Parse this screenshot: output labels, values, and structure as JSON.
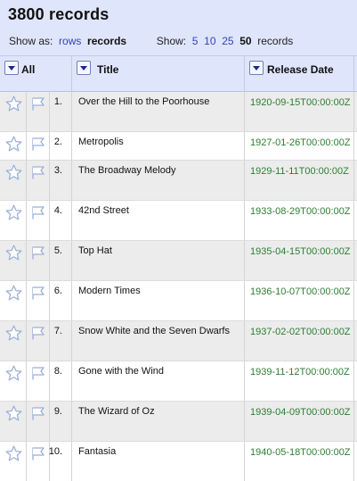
{
  "header": {
    "record_count": "3800 records",
    "show_as_label": "Show as:",
    "view_rows": "rows",
    "view_records": "records",
    "show_label": "Show:",
    "page_sizes": [
      "5",
      "10",
      "25"
    ],
    "page_size_selected": "50",
    "page_size_suffix": "records"
  },
  "columns": {
    "all": "All",
    "title": "Title",
    "release_date": "Release Date"
  },
  "rows": [
    {
      "num": "1.",
      "title": "Over the Hill to the Poorhouse",
      "date": "1920-09-15T00:00:00Z"
    },
    {
      "num": "2.",
      "title": "Metropolis",
      "date": "1927-01-26T00:00:00Z"
    },
    {
      "num": "3.",
      "title": "The Broadway Melody",
      "date": "1929-11-11T00:00:00Z"
    },
    {
      "num": "4.",
      "title": "42nd Street",
      "date": "1933-08-29T00:00:00Z"
    },
    {
      "num": "5.",
      "title": "Top Hat",
      "date": "1935-04-15T00:00:00Z"
    },
    {
      "num": "6.",
      "title": "Modern Times",
      "date": "1936-10-07T00:00:00Z"
    },
    {
      "num": "7.",
      "title": "Snow White and the Seven Dwarfs",
      "date": "1937-02-02T00:00:00Z"
    },
    {
      "num": "8.",
      "title": "Gone with the Wind",
      "date": "1939-11-12T00:00:00Z"
    },
    {
      "num": "9.",
      "title": "The Wizard of Oz",
      "date": "1939-04-09T00:00:00Z"
    },
    {
      "num": "10.",
      "title": "Fantasia",
      "date": "1940-05-18T00:00:00Z"
    }
  ],
  "colors": {
    "header_bg": "#dfe5fb",
    "link": "#3344bb",
    "date_text": "#2e7d32",
    "odd_row": "#ececec"
  },
  "icons": {
    "star": "star-icon",
    "flag": "flag-icon",
    "dropdown": "dropdown-arrow-icon"
  }
}
